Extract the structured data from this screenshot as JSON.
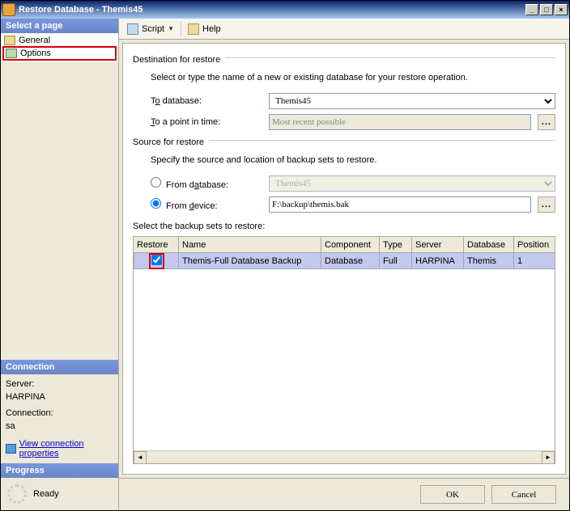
{
  "window": {
    "title": "Restore Database - Themis45"
  },
  "sidebar": {
    "select_page": "Select a page",
    "pages": {
      "general": "General",
      "options": "Options"
    },
    "connection": {
      "header": "Connection",
      "server_label": "Server:",
      "server_value": "HARPINA",
      "conn_label": "Connection:",
      "conn_value": "sa",
      "view_link": "View connection properties"
    },
    "progress": {
      "header": "Progress",
      "status": "Ready"
    }
  },
  "toolbar": {
    "script": "Script",
    "help": "Help"
  },
  "dest": {
    "header": "Destination for restore",
    "desc": "Select or type the name of a new or existing database for your restore operation.",
    "to_db_label": "To database:",
    "to_db_value": "Themis45",
    "to_point_label": "To a point in time:",
    "to_point_value": "Most recent possible"
  },
  "source": {
    "header": "Source for restore",
    "desc": "Specify the source and location of backup sets to restore.",
    "from_db_label": "From database:",
    "from_db_value": "Themis45",
    "from_device_label": "From device:",
    "from_device_value": "F:\\backup\\themis.bak",
    "sets_label": "Select the backup sets to restore:"
  },
  "grid": {
    "headers": {
      "restore": "Restore",
      "name": "Name",
      "component": "Component",
      "type": "Type",
      "server": "Server",
      "database": "Database",
      "position": "Position"
    },
    "row": {
      "name": "Themis-Full Database Backup",
      "component": "Database",
      "type": "Full",
      "server": "HARPINA",
      "database": "Themis",
      "position": "1"
    }
  },
  "buttons": {
    "ok": "OK",
    "cancel": "Cancel",
    "ellipsis": "..."
  }
}
